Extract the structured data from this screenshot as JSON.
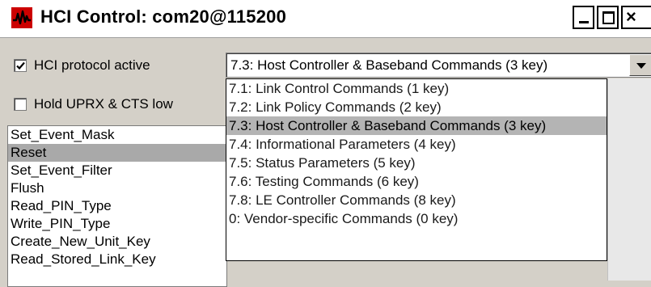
{
  "window": {
    "title": "HCI Control: com20@115200",
    "icon": "waveform-icon",
    "close_glyph": "×",
    "accent": "#cc0000"
  },
  "options": {
    "hci_active": {
      "label": "HCI protocol active",
      "checked": true
    },
    "hold_lines": {
      "label": "Hold UPRX & CTS low",
      "checked": false
    }
  },
  "group_select": {
    "value": "7.3: Host Controller & Baseband Commands (3 key)",
    "options": [
      "7.1: Link Control Commands (1 key)",
      "7.2: Link Policy Commands (2 key)",
      "7.3: Host Controller & Baseband Commands (3 key)",
      "7.4: Informational Parameters (4 key)",
      "7.5: Status Parameters (5 key)",
      "7.6: Testing Commands (6 key)",
      "7.8: LE Controller Commands (8 key)",
      "0: Vendor-specific Commands (0 key)"
    ],
    "selected_index": 2
  },
  "commands": {
    "items": [
      "Set_Event_Mask",
      "Reset",
      "Set_Event_Filter",
      "Flush",
      "Read_PIN_Type",
      "Write_PIN_Type",
      "Create_New_Unit_Key",
      "Read_Stored_Link_Key"
    ],
    "selected_index": 1
  }
}
